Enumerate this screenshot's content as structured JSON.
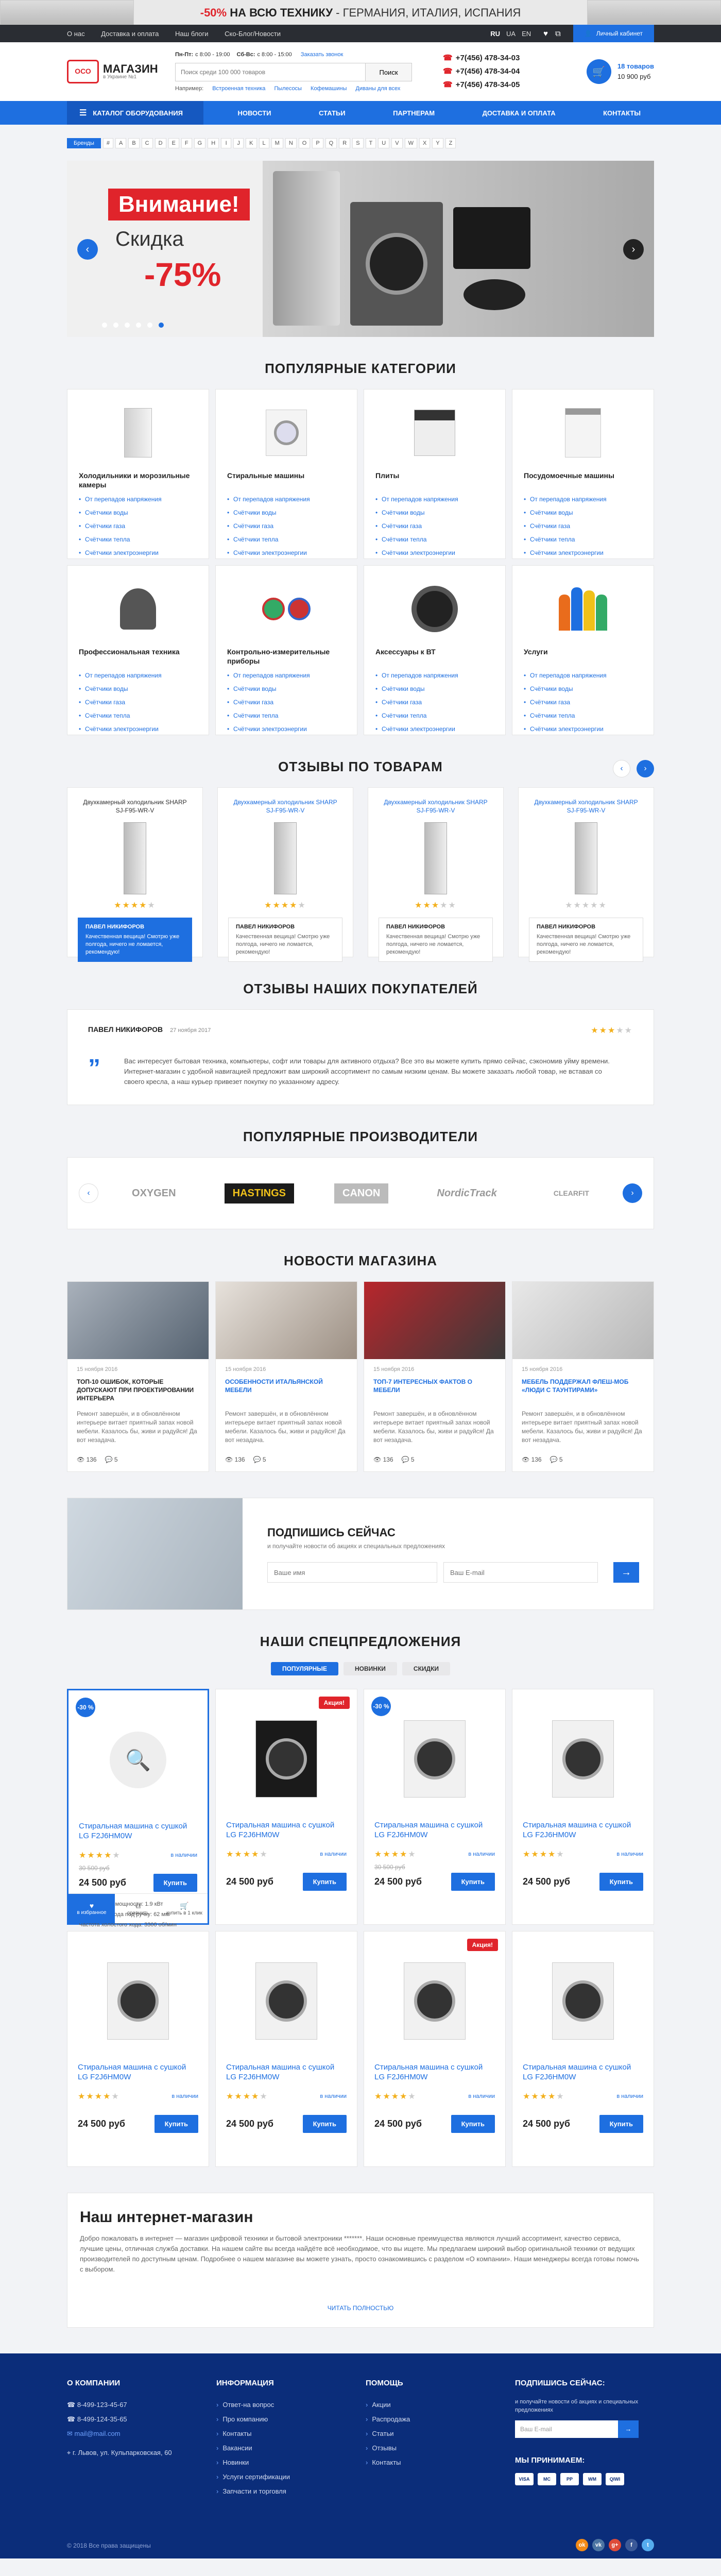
{
  "promo": {
    "pct": "-50%",
    "main": "НА ВСЮ ТЕХНИКУ",
    "dash": "-",
    "countries": "ГЕРМАНИЯ, ИТАЛИЯ, ИСПАНИЯ"
  },
  "topbar": {
    "links": [
      "О нас",
      "Доставка и оплата",
      "Наш блоги",
      "Ско-Блог/Новости"
    ],
    "langs": [
      "RU",
      "UA",
      "EN"
    ],
    "cabinet": "Личный кабинет"
  },
  "header": {
    "logo_box": "ОСО",
    "logo_name": "МАГАЗИН",
    "logo_sub": "в Украине №1",
    "schedule_days": "Пн-Пт:",
    "schedule_time": "с 8:00 - 19:00",
    "schedule_days2": "Сб-Вс:",
    "schedule_time2": "с 8:00 - 15:00",
    "callback": "Заказать звонок",
    "search_placeholder": "Поиск среди 100 000 товаров",
    "search_button": "Поиск",
    "quick_label": "Например:",
    "quick": [
      "Встроенная техника",
      "Пылесосы",
      "Кофемашины",
      "Диваны для всех"
    ],
    "phones": [
      "+7(456) 478-34-03",
      "+7(456) 478-34-04",
      "+7(456) 478-34-05"
    ],
    "cart_count": "18 товаров",
    "cart_sum": "10 900 руб"
  },
  "nav": [
    "КАТАЛОГ ОБОРУДОВАНИЯ",
    "НОВОСТИ",
    "СТАТЬИ",
    "ПАРТНЕРАМ",
    "ДОСТАВКА И ОПЛАТА",
    "КОНТАКТЫ"
  ],
  "abc": {
    "label": "Бренды",
    "letters": [
      "#",
      "A",
      "B",
      "C",
      "D",
      "E",
      "F",
      "G",
      "H",
      "I",
      "J",
      "K",
      "L",
      "M",
      "N",
      "O",
      "P",
      "Q",
      "R",
      "S",
      "T",
      "U",
      "V",
      "W",
      "X",
      "Y",
      "Z"
    ]
  },
  "slider": {
    "attention": "Внимание!",
    "discount": "Скидка",
    "pct": "-75%"
  },
  "categories": {
    "title": "ПОПУЛЯРНЫЕ КАТЕГОРИИ",
    "items": [
      {
        "name": "Холодильники и морозильные камеры",
        "subs": [
          "От перепадов напряжения",
          "Счётчики воды",
          "Счётчики газа",
          "Счётчики тепла",
          "Счётчики электроэнергии"
        ]
      },
      {
        "name": "Стиральные машины",
        "subs": [
          "От перепадов напряжения",
          "Счётчики воды",
          "Счётчики газа",
          "Счётчики тепла",
          "Счётчики электроэнергии"
        ]
      },
      {
        "name": "Плиты",
        "subs": [
          "От перепадов напряжения",
          "Счётчики воды",
          "Счётчики газа",
          "Счётчики тепла",
          "Счётчики электроэнергии"
        ]
      },
      {
        "name": "Посудомоечные машины",
        "subs": [
          "От перепадов напряжения",
          "Счётчики воды",
          "Счётчики газа",
          "Счётчики тепла",
          "Счётчики электроэнергии"
        ]
      },
      {
        "name": "Профессиональная техника",
        "subs": [
          "От перепадов напряжения",
          "Счётчики воды",
          "Счётчики газа",
          "Счётчики тепла",
          "Счётчики электроэнергии"
        ]
      },
      {
        "name": "Контрольно-измерительные приборы",
        "subs": [
          "От перепадов напряжения",
          "Счётчики воды",
          "Счётчики газа",
          "Счётчики тепла",
          "Счётчики электроэнергии"
        ]
      },
      {
        "name": "Аксессуары к ВТ",
        "subs": [
          "От перепадов напряжения",
          "Счётчики воды",
          "Счётчики газа",
          "Счётчики тепла",
          "Счётчики электроэнергии"
        ]
      },
      {
        "name": "Услуги",
        "subs": [
          "От перепадов напряжения",
          "Счётчики воды",
          "Счётчики газа",
          "Счётчики тепла",
          "Счётчики электроэнергии"
        ]
      }
    ]
  },
  "reviews": {
    "title": "ОТЗЫВЫ ПО ТОВАРАМ",
    "items": [
      {
        "product": "Двухкамерный холодильник SHARP SJ-F95-WR-V",
        "author": "ПАВЕЛ НИКИФОРОВ",
        "text": "Качественная вещица! Смотрю уже полгода, ничего не ломается, рекомендую!"
      },
      {
        "product": "Двухкамерный холодильник SHARP SJ-F95-WR-V",
        "author": "ПАВЕЛ НИКИФОРОВ",
        "text": "Качественная вещица! Смотрю уже полгода, ничего не ломается, рекомендую!"
      },
      {
        "product": "Двухкамерный холодильник SHARP SJ-F95-WR-V",
        "author": "ПАВЕЛ НИКИФОРОВ",
        "text": "Качественная вещица! Смотрю уже полгода, ничего не ломается, рекомендую!"
      },
      {
        "product": "Двухкамерный холодильник SHARP SJ-F95-WR-V",
        "author": "ПАВЕЛ НИКИФОРОВ",
        "text": "Качественная вещица! Смотрю уже полгода, ничего не ломается, рекомендую!"
      }
    ]
  },
  "testimonials": {
    "title": "ОТЗЫВЫ НАШИХ ПОКУПАТЕЛЕЙ",
    "name": "ПАВЕЛ НИКИФОРОВ",
    "date": "27 ноября 2017",
    "text": "Вас интересует бытовая техника, компьютеры, софт или товары для активного отдыха? Все это вы можете купить прямо сейчас, сэкономив уйму времени. Интернет-магазин с удобной навигацией предложит вам широкий ассортимент по самым низким ценам. Вы можете заказать любой товар, не вставая со своего кресла, а наш курьер привезет покупку по указанному адресу."
  },
  "brands": {
    "title": "ПОПУЛЯРНЫЕ ПРОИЗВОДИТЕЛИ",
    "items": [
      "OXYGEN",
      "HASTINGS",
      "CANON",
      "NordicTrack",
      "CLEARFIT"
    ]
  },
  "news": {
    "title": "НОВОСТИ МАГАЗИНА",
    "items": [
      {
        "date": "15 ноября 2016",
        "title": "ТОП-10 ошибок, которые допускают при проектировании интерьера",
        "text": "Ремонт завершён, и в обновлённом интерьере витает приятный запах новой мебели. Казалось бы, живи и радуйся! Да вот незадача.",
        "views": "136",
        "comments": "5"
      },
      {
        "date": "15 ноября 2016",
        "title": "Особенности итальянской мебели",
        "text": "Ремонт завершён, и в обновлённом интерьере витает приятный запах новой мебели. Казалось бы, живи и радуйся! Да вот незадача.",
        "views": "136",
        "comments": "5"
      },
      {
        "date": "15 ноября 2016",
        "title": "ТОП-7 интересных фактов о мебели",
        "text": "Ремонт завершён, и в обновлённом интерьере витает приятный запах новой мебели. Казалось бы, живи и радуйся! Да вот незадача.",
        "views": "136",
        "comments": "5"
      },
      {
        "date": "15 ноября 2016",
        "title": "Мебель поддержал флеш-моб «люди с таунтирами»",
        "text": "Ремонт завершён, и в обновлённом интерьере витает приятный запах новой мебели. Казалось бы, живи и радуйся! Да вот незадача.",
        "views": "136",
        "comments": "5"
      }
    ]
  },
  "subscribe": {
    "title": "ПОДПИШИСЬ СЕЙЧАС",
    "sub": "и получайте новости об акциях и специальных предложениях",
    "name_ph": "Ваше имя",
    "email_ph": "Ваш E-mail"
  },
  "specials": {
    "title": "НАШИ СПЕЦПРЕДЛОЖЕНИЯ",
    "tabs": [
      "ПОПУЛЯРНЫЕ",
      "НОВИНКИ",
      "СКИДКИ"
    ],
    "items": [
      {
        "badge": "-30 %",
        "badge_type": "blue",
        "name": "Стиральная машина с сушкой LG F2J6HM0W",
        "avail": "в наличии",
        "old": "30 500 руб",
        "price": "24 500 руб",
        "buy": "Купить",
        "rating": 4
      },
      {
        "badge": "Акция!",
        "badge_type": "red",
        "name": "Стиральная машина с сушкой LG F2J6HM0W",
        "avail": "в наличии",
        "old": "",
        "price": "24 500 руб",
        "buy": "Купить",
        "rating": 4
      },
      {
        "badge": "-30 %",
        "badge_type": "blue",
        "name": "Стиральная машина с сушкой LG F2J6HM0W",
        "avail": "в наличии",
        "old": "30 500 руб",
        "price": "24 500 руб",
        "buy": "Купить",
        "rating": 4
      },
      {
        "badge": "",
        "badge_type": "",
        "name": "Стиральная машина с сушкой LG F2J6HM0W",
        "avail": "в наличии",
        "old": "",
        "price": "24 500 руб",
        "buy": "Купить",
        "rating": 4
      },
      {
        "badge": "",
        "badge_type": "",
        "name": "Стиральная машина с сушкой LG F2J6HM0W",
        "avail": "в наличии",
        "old": "",
        "price": "24 500 руб",
        "buy": "Купить",
        "rating": 4
      },
      {
        "badge": "",
        "badge_type": "",
        "name": "Стиральная машина с сушкой LG F2J6HM0W",
        "avail": "в наличии",
        "old": "",
        "price": "24 500 руб",
        "buy": "Купить",
        "rating": 4
      },
      {
        "badge": "Акция!",
        "badge_type": "red",
        "name": "Стиральная машина с сушкой LG F2J6HM0W",
        "avail": "в наличии",
        "old": "",
        "price": "24 500 руб",
        "buy": "Купить",
        "rating": 4
      },
      {
        "badge": "",
        "badge_type": "",
        "name": "Стиральная машина с сушкой LG F2J6HM0W",
        "avail": "в наличии",
        "old": "",
        "price": "24 500 руб",
        "buy": "Купить",
        "rating": 4
      }
    ],
    "active_props": [
      "Потребление мощности: 1.9 кВт",
      "Глубина прохода под ручку: 62 мм",
      "Частота холостого хода: 3300 об/мин",
      "Диаметр патрона: 100 мм"
    ],
    "toolbar": [
      "в избранное",
      "сравнить",
      "купить в 1 клик"
    ]
  },
  "about": {
    "title": "Наш интернет-магазин",
    "text": "Добро пожаловать в интернет — магазин цифровой техники и бытовой электроники *******. Наши основные преимущества являются лучший ассортимент, качество сервиса, лучшие цены, отличная служба доставки. На нашем сайте вы всегда найдёте всё необходимое, что вы ищете. Мы предлагаем широкий выбор оригинальной техники от ведущих производителей по доступным ценам. Подробнее о нашем магазине вы можете узнать, просто ознакомившись с разделом «О компании». Наши менеджеры всегда готовы помочь с выбором.",
    "more": "ЧИТАТЬ ПОЛНОСТЬЮ"
  },
  "footer": {
    "col1": {
      "title": "О КОМПАНИИ",
      "phones": [
        "8-499-123-45-67",
        "8-499-124-35-65"
      ],
      "email": "mail@mail.com",
      "address": "г. Львов, ул. Кульпарковская, 60"
    },
    "col2": {
      "title": "ИНФОРМАЦИЯ",
      "items": [
        "Ответ-на вопрос",
        "Про компанию",
        "Контакты",
        "Вакансии",
        "Новинки",
        "Услуги сертификации",
        "Запчасти и торговля"
      ]
    },
    "col3": {
      "title": "ПОМОЩЬ",
      "items": [
        "Акции",
        "Распродажа",
        "Статьи",
        "Отзывы",
        "Контакты"
      ]
    },
    "col4": {
      "title": "ПОДПИШИСЬ СЕЙЧАС:",
      "sub": "и получайте новости об акциях и специальных предложениях",
      "ph": "Ваш E-mail",
      "pay_title": "МЫ ПРИНИМАЕМ:",
      "pays": [
        "VISA",
        "MC",
        "PP",
        "WM",
        "QIWI"
      ]
    },
    "copy": "© 2018 Все права защищены"
  }
}
